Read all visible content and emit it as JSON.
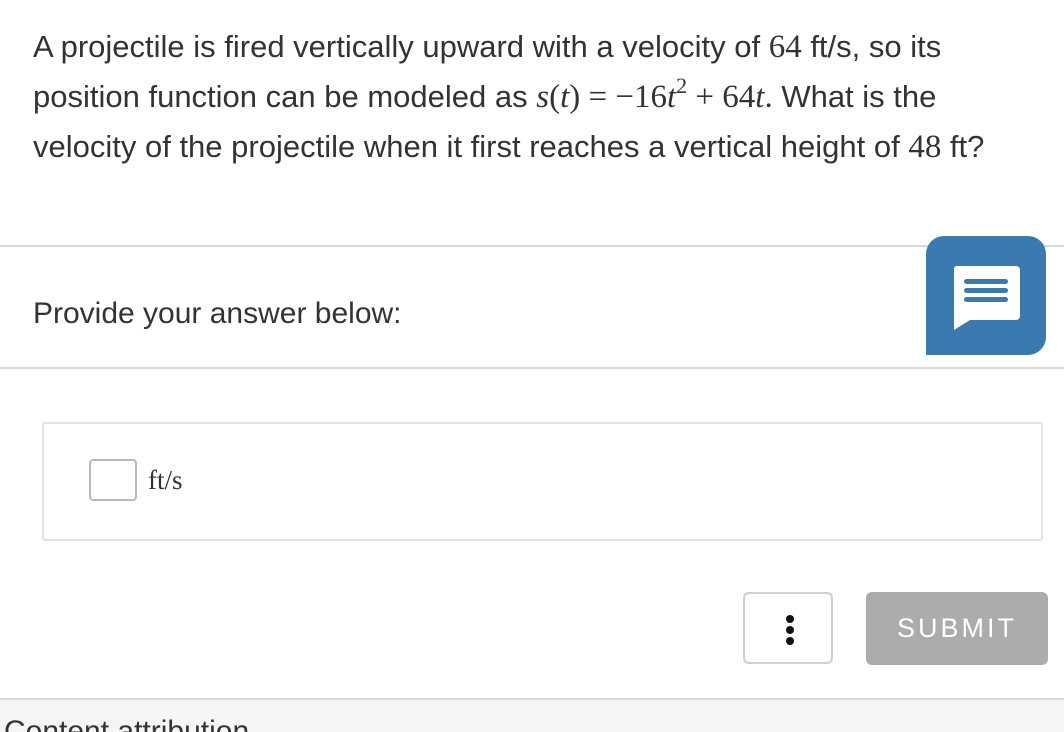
{
  "question": {
    "part1": "A projectile is fired vertically upward with a velocity of ",
    "velocity_value": "64",
    "part2": " ft/s, so its position function can be modeled as ",
    "fn_name": "s",
    "fn_open": "(",
    "fn_var": "t",
    "fn_close": ")",
    "equals": " = −16",
    "t_var": "t",
    "exponent": "2",
    "plus": " + 64",
    "t_var2": "t",
    "period": ".",
    "part3": " What is the velocity of the projectile when it first reaches a vertical height of ",
    "height_value": "48",
    "part4": " ft?"
  },
  "prompt": "Provide your answer below:",
  "answer": {
    "value": "",
    "unit": "ft/s"
  },
  "buttons": {
    "submit": "SUBMIT"
  },
  "footer": {
    "text": "Content attribution"
  },
  "colors": {
    "chat_button": "#3a7ab1",
    "submit_disabled": "#acacac"
  },
  "icons": {
    "chat": "chat-bubble-icon",
    "more": "more-options-icon"
  }
}
